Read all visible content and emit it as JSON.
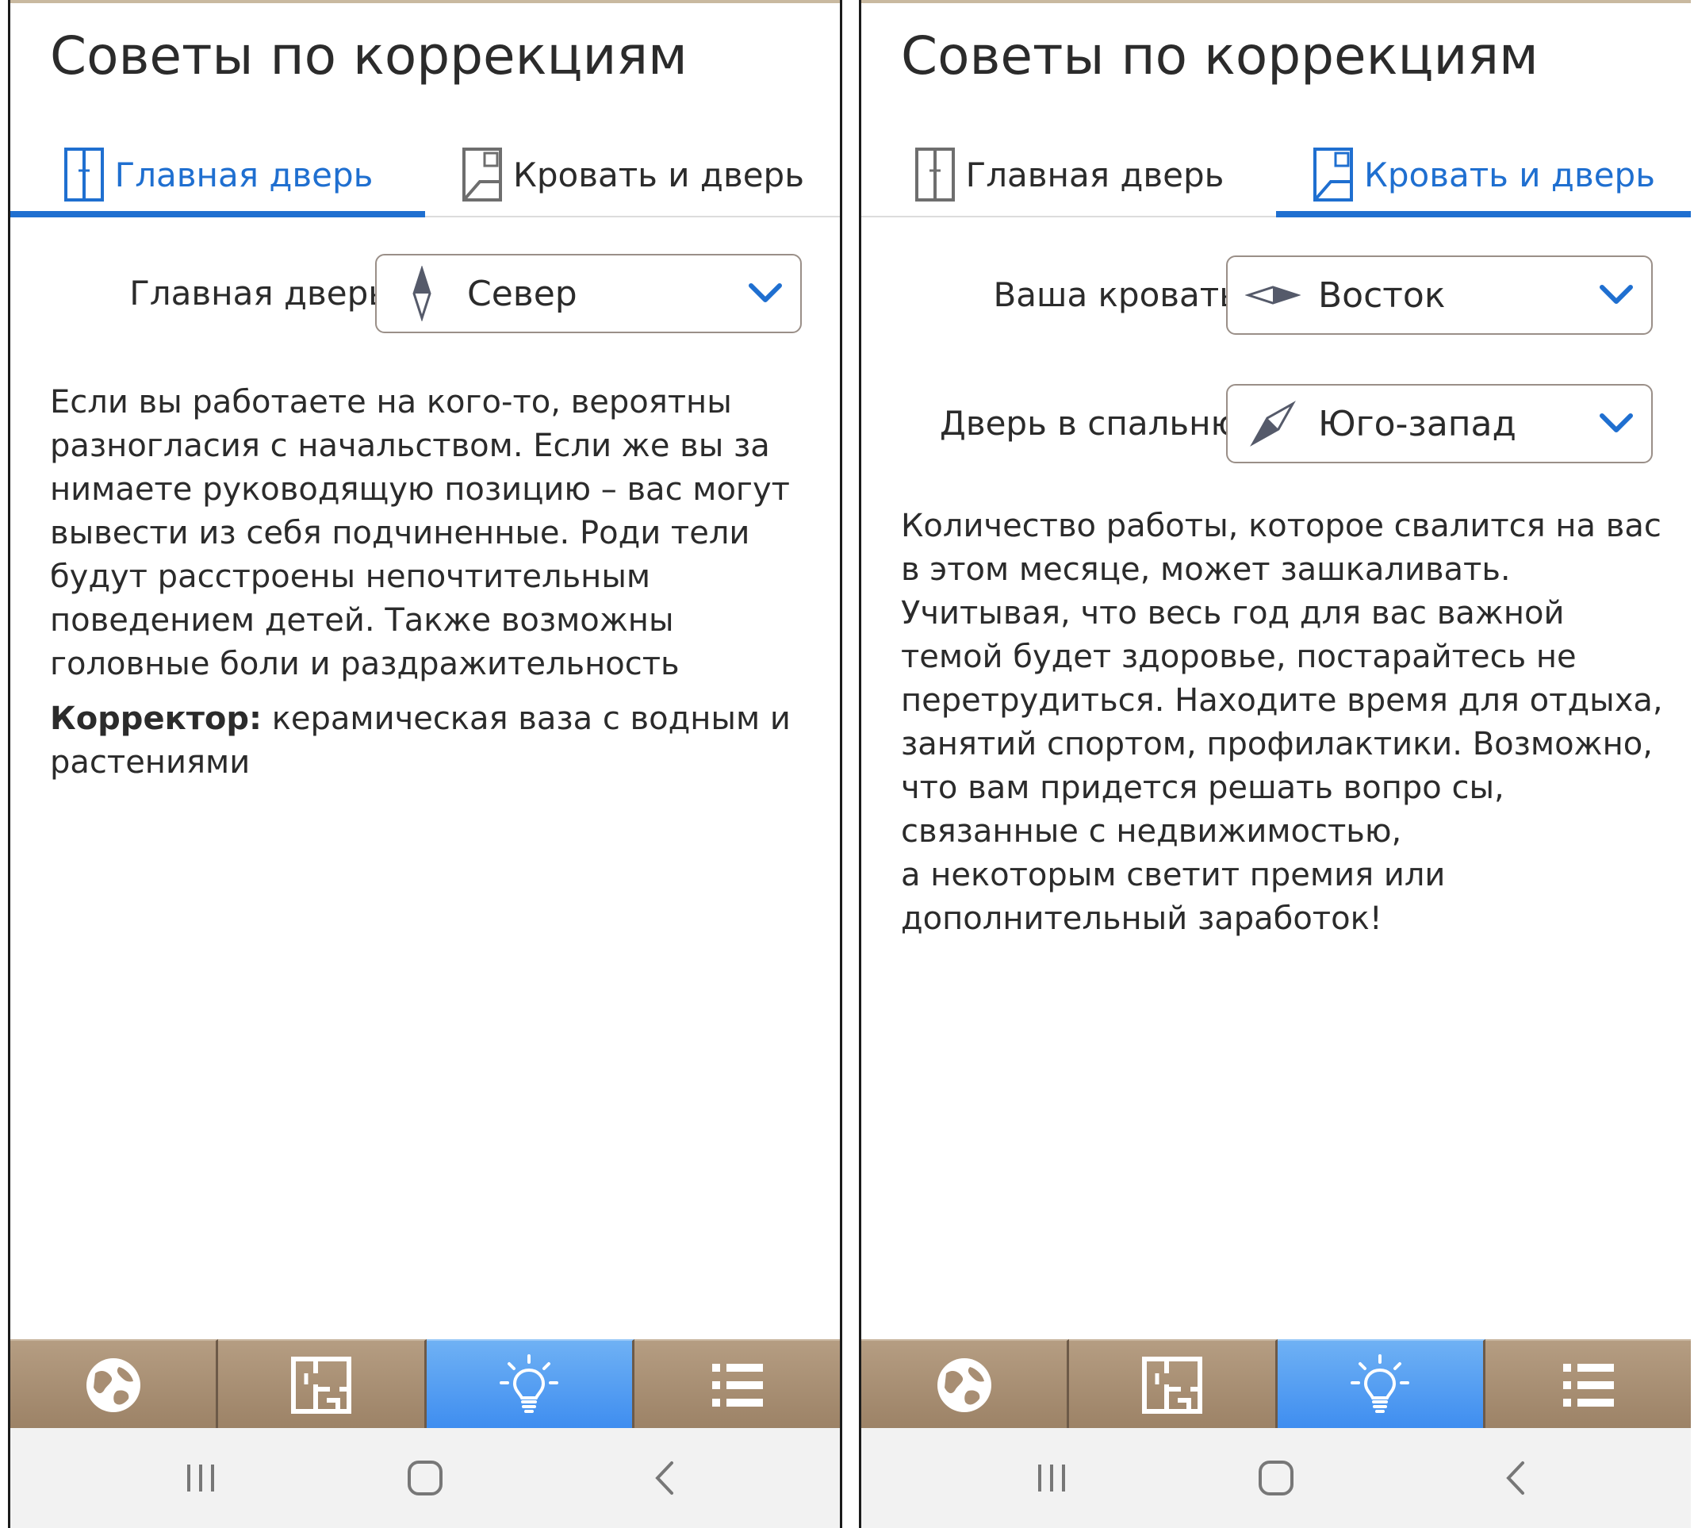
{
  "colors": {
    "accent": "#1f6fd0",
    "nav_bg": "#a88e73",
    "nav_active": "#4f9cf2",
    "text": "#2b2b2b"
  },
  "screens": [
    {
      "title": "Советы по коррекциям",
      "tabs": [
        {
          "label": "Главная дверь",
          "icon": "door-icon",
          "active": true
        },
        {
          "label": "Кровать и дверь",
          "icon": "bed-door-icon",
          "active": false
        }
      ],
      "selects": [
        {
          "label": "Главная дверь",
          "value": "Север",
          "icon": "compass-north-icon"
        }
      ],
      "paragraphs": [
        "Если вы работаете на кого-то, вероятны разногласия с начальством. Если же вы за нимаете руководящую позицию – вас могут вывести из себя подчиненные. Роди тели будут расстроены непочтительным поведением детей. Также возможны головные боли и раздражительность"
      ],
      "corrector_label": "Корректор:",
      "corrector_text": " керамическая ваза с водным и растениями"
    },
    {
      "title": "Советы по коррекциям",
      "tabs": [
        {
          "label": "Главная дверь",
          "icon": "door-icon",
          "active": false
        },
        {
          "label": "Кровать и дверь",
          "icon": "bed-door-icon",
          "active": true
        }
      ],
      "selects": [
        {
          "label": "Ваша кровать",
          "value": "Восток",
          "icon": "compass-east-icon"
        },
        {
          "label": "Дверь в спальню",
          "value": "Юго-запад",
          "icon": "compass-southwest-icon"
        }
      ],
      "paragraphs": [
        "Количество работы, которое свалится на вас в этом месяце, может зашкаливать. Учитывая, что весь год для вас важной темой будет здоровье, постарайтесь не перетрудиться. Находите время для отдыха, занятий спортом, профилактики. Возможно, что вам придется решать вопро сы, связанные с недвижимостью,",
        "а некоторым светит премия или дополнительный заработок!"
      ]
    }
  ],
  "bottom_nav": [
    {
      "icon": "globe-icon",
      "active": false
    },
    {
      "icon": "floorplan-icon",
      "active": false
    },
    {
      "icon": "lightbulb-icon",
      "active": true
    },
    {
      "icon": "list-icon",
      "active": false
    }
  ],
  "system_nav": [
    {
      "icon": "recent-apps-icon"
    },
    {
      "icon": "home-icon"
    },
    {
      "icon": "back-icon"
    }
  ]
}
